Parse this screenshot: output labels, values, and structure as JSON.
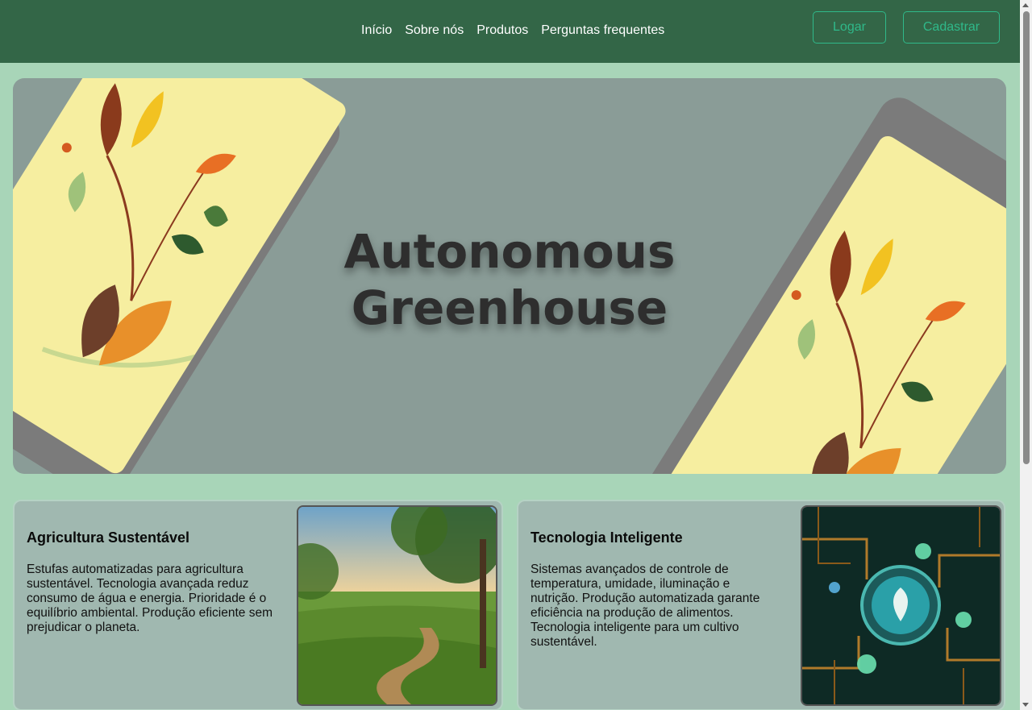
{
  "nav": {
    "links": [
      "Início",
      "Sobre nós",
      "Produtos",
      "Perguntas frequentes"
    ],
    "login_label": "Logar",
    "signup_label": "Cadastrar"
  },
  "hero": {
    "title_line1": "Autonomous",
    "title_line2": "Greenhouse"
  },
  "cards": [
    {
      "title": "Agricultura Sustentável",
      "text": "Estufas automatizadas para agricultura sustentável. Tecnologia avançada reduz consumo de água e energia. Prioridade é o equilíbrio ambiental. Produção eficiente sem prejudicar o planeta."
    },
    {
      "title": "Tecnologia Inteligente",
      "text": "Sistemas avançados de controle de temperatura, umidade, iluminação e nutrição. Produção automatizada garante eficiência na produção de alimentos. Tecnologia inteligente para um cultivo sustentável."
    }
  ],
  "colors": {
    "navbar": "#336647",
    "page_bg": "#a8d5b8",
    "accent": "#2fb98a",
    "hero_bg": "#8a9c97"
  }
}
